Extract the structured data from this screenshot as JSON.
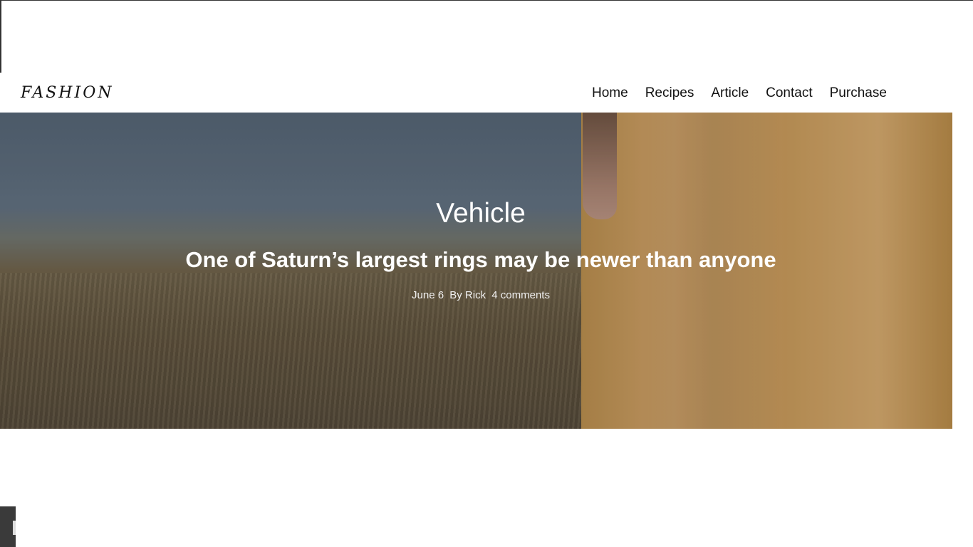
{
  "logo": "FASHION",
  "nav": {
    "items": [
      "Home",
      "Recipes",
      "Article",
      "Contact",
      "Purchase"
    ]
  },
  "hero": {
    "category": "Vehicle",
    "headline": "One of Saturn’s largest rings may be newer than anyone",
    "meta": {
      "date": "June 6",
      "author": "By Rick",
      "comments": "4 comments"
    }
  }
}
